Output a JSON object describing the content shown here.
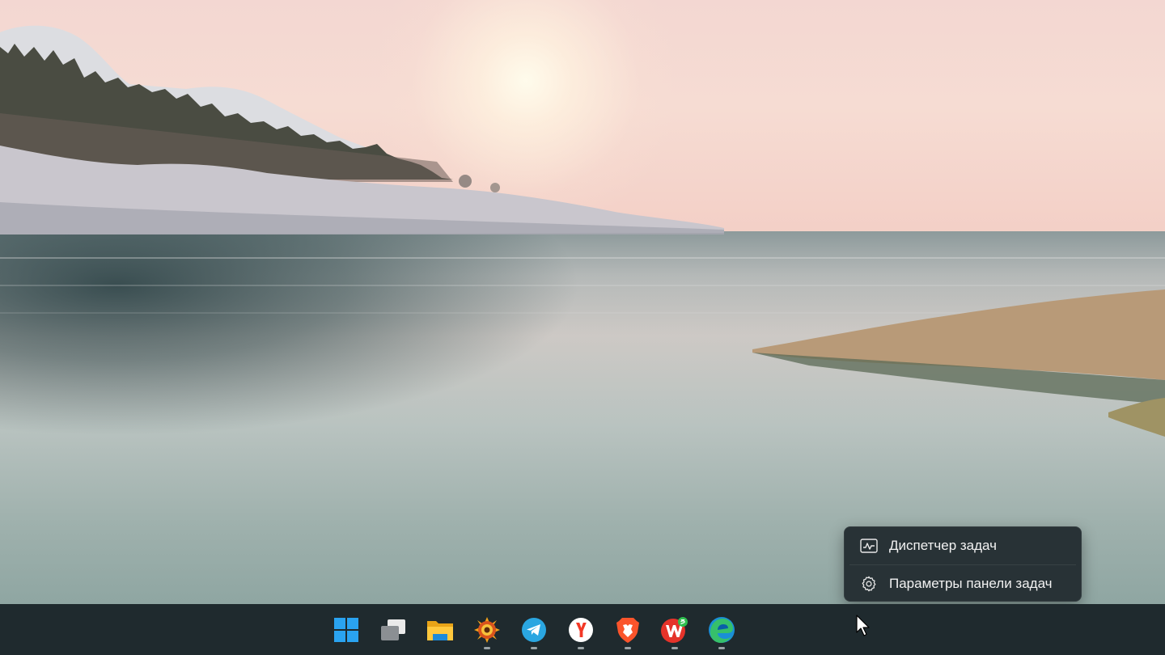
{
  "context_menu": {
    "items": [
      {
        "label": "Диспетчер задач",
        "icon": "task-manager-icon"
      },
      {
        "label": "Параметры панели задач",
        "icon": "gear-icon"
      }
    ]
  },
  "taskbar": {
    "apps": [
      {
        "icon": "windows-start-icon",
        "running": false
      },
      {
        "icon": "task-view-icon",
        "running": false
      },
      {
        "icon": "file-explorer-icon",
        "running": false
      },
      {
        "icon": "xnview-icon",
        "running": true
      },
      {
        "icon": "telegram-icon",
        "running": true
      },
      {
        "icon": "yandex-browser-icon",
        "running": true
      },
      {
        "icon": "brave-browser-icon",
        "running": true
      },
      {
        "icon": "wps-office-icon",
        "running": true
      },
      {
        "icon": "edge-browser-icon",
        "running": true
      }
    ]
  },
  "colors": {
    "taskbar_bg": "#1f2a2e",
    "menu_bg": "#283236",
    "start_blue": "#2aa3f0"
  }
}
